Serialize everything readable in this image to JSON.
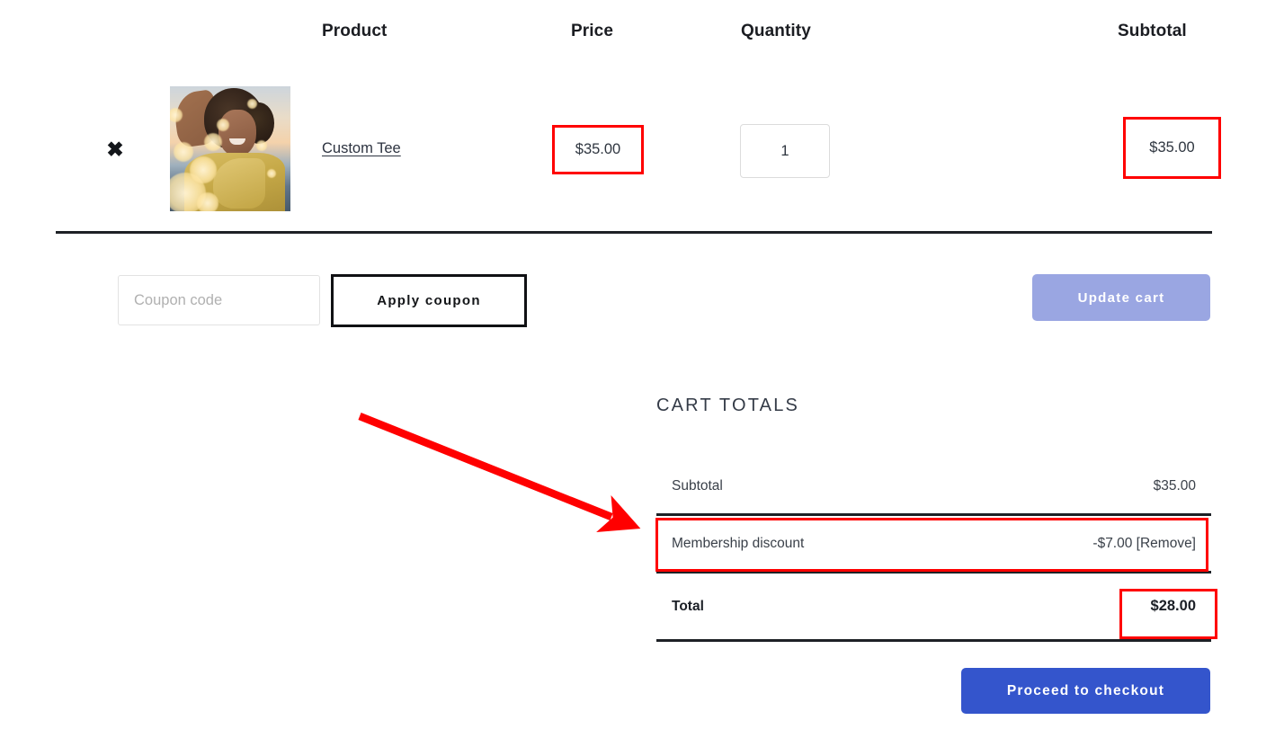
{
  "table": {
    "headers": {
      "product": "Product",
      "price": "Price",
      "quantity": "Quantity",
      "subtotal": "Subtotal"
    },
    "rows": [
      {
        "remove_icon": "close-x-icon",
        "thumbnail_alt": "Woman in yellow top with bokeh lights",
        "name": "Custom Tee",
        "price": "$35.00",
        "quantity": "1",
        "subtotal": "$35.00"
      }
    ]
  },
  "coupon": {
    "placeholder": "Coupon code",
    "value": "",
    "apply_label": "Apply coupon"
  },
  "actions": {
    "update_cart_label": "Update cart",
    "checkout_label": "Proceed to checkout"
  },
  "totals": {
    "title": "CART TOTALS",
    "rows": [
      {
        "label": "Subtotal",
        "value": "$35.00"
      },
      {
        "label": "Membership discount",
        "value": "-$7.00 [Remove]"
      },
      {
        "label": "Total",
        "value": "$28.00"
      }
    ]
  },
  "annotations": {
    "color": "#ff0000",
    "boxes": [
      "price-cell",
      "subtotal-cell",
      "membership-discount-row",
      "total-value"
    ],
    "arrow": "points-to-membership-discount-row"
  }
}
